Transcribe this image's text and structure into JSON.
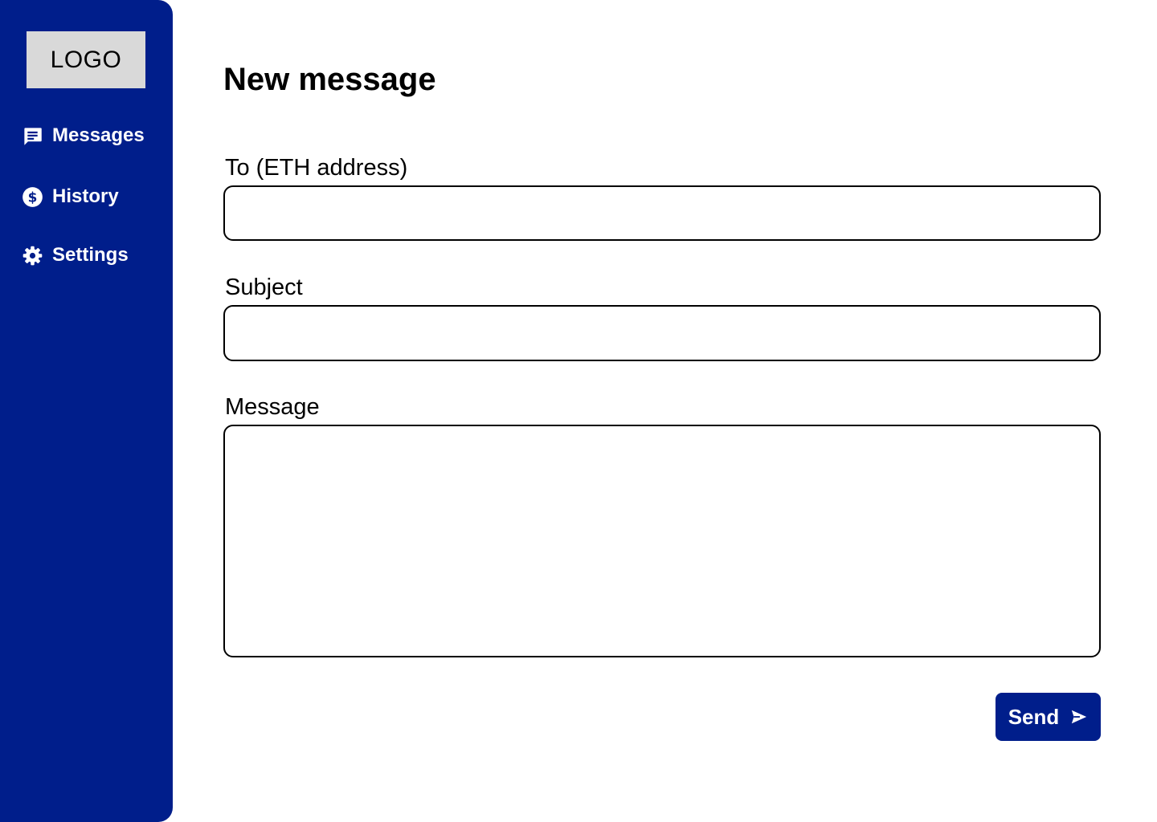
{
  "sidebar": {
    "logo_text": "LOGO",
    "items": [
      {
        "label": "Messages",
        "icon": "message-icon"
      },
      {
        "label": "History",
        "icon": "dollar-circle-icon"
      },
      {
        "label": "Settings",
        "icon": "gear-icon"
      }
    ]
  },
  "main": {
    "title": "New message",
    "fields": {
      "to": {
        "label": "To (ETH address)",
        "value": "",
        "placeholder": ""
      },
      "subject": {
        "label": "Subject",
        "value": "",
        "placeholder": ""
      },
      "message": {
        "label": "Message",
        "value": "",
        "placeholder": ""
      }
    },
    "send_label": "Send"
  },
  "colors": {
    "sidebar_bg": "#001e8b",
    "logo_bg": "#d9d9d9",
    "button_bg": "#001e8b",
    "text": "#000000",
    "nav_text": "#ffffff"
  }
}
